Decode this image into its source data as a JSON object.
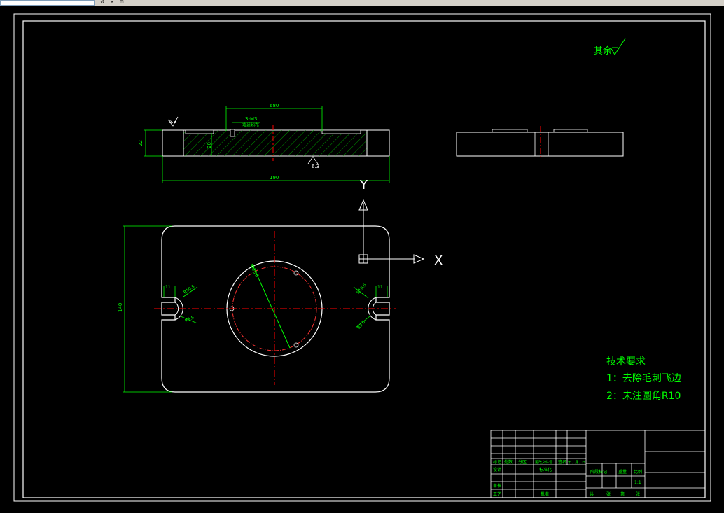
{
  "toolbar": {
    "buttons": [
      "↺",
      "✕",
      "⊡"
    ]
  },
  "drawing": {
    "roughness_note": "其余",
    "section_view": {
      "hole_note_line1": "3-M3",
      "hole_note_line2": "攻丝均布",
      "dim_top_width": "680",
      "dim_height": "22",
      "dim_inner_height": "20",
      "dim_total_width": "190",
      "surface_left": "6.3",
      "surface_bottom": "6.3"
    },
    "plan_view": {
      "dim_height": "140",
      "slot_left_r": "R10.5",
      "slot_left_r2": "R5.5",
      "slot_left_w": "11",
      "slot_right_r": "R10.5",
      "slot_right_r2": "R5.5",
      "slot_right_w": "11",
      "circle_dia": "Φ110"
    },
    "ucs": {
      "x_label": "X",
      "y_label": "Y"
    },
    "tech_requirements": {
      "title": "技术要求",
      "item1": "1：去除毛刺飞边",
      "item2": "2：未注圆角R10"
    },
    "title_block": {
      "row_labels": [
        "标记",
        "处数",
        "分区",
        "更改文件号",
        "签名",
        "年、月、日"
      ],
      "design": "设计",
      "standardize": "标准化",
      "review": "审核",
      "process": "工艺",
      "approve": "批准",
      "stage_mark": "阶段标记",
      "weight": "重量",
      "scale": "比例",
      "scale_value": "1:1",
      "sheets": [
        "共",
        "张",
        "第",
        "张"
      ]
    }
  },
  "colors": {
    "background": "#000000",
    "frame": "#ffffff",
    "dimension": "#00ff00",
    "centerline": "#ff0000",
    "hatch": "#00cc00"
  }
}
